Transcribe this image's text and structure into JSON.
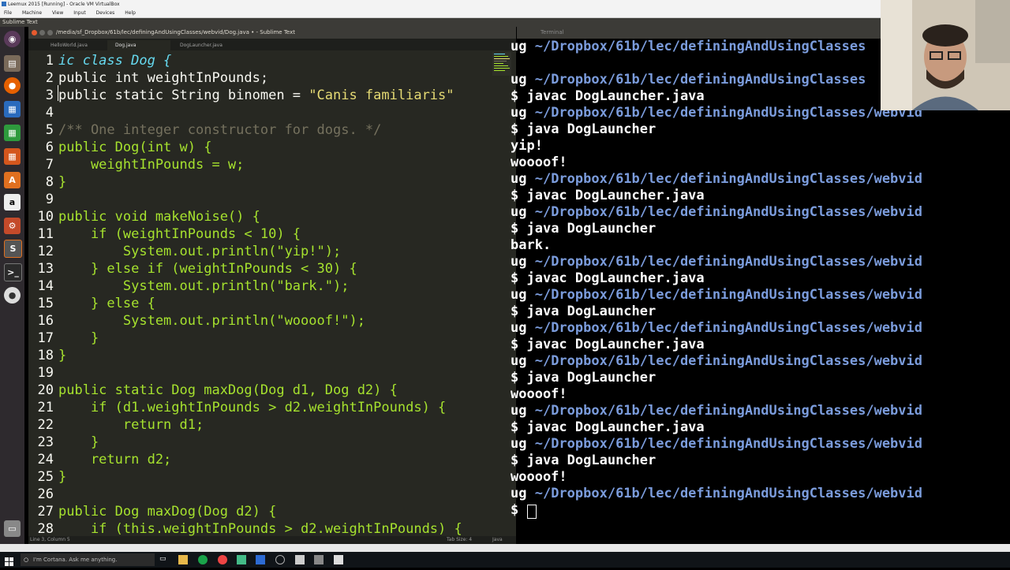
{
  "vbox": {
    "title": "Leemux 2015 [Running] - Oracle VM VirtualBox",
    "menu": [
      "File",
      "Machine",
      "View",
      "Input",
      "Devices",
      "Help"
    ]
  },
  "panel": {
    "app_name": "Sublime Text"
  },
  "sublime": {
    "title": "/media/sf_Dropbox/61b/lec/definingAndUsingClasses/webvid/Dog.java • - Sublime Text",
    "tabs": [
      "HelloWorld.java",
      "Dog.java",
      "DogLauncher.java"
    ],
    "status_left": "Line 3, Column 5",
    "tab_size": "Tab Size: 4",
    "syntax": "Java"
  },
  "code_lines": [
    {
      "n": "1"
    },
    {
      "n": "2"
    },
    {
      "n": "3"
    },
    {
      "n": "4"
    },
    {
      "n": "5"
    },
    {
      "n": "6"
    },
    {
      "n": "7"
    },
    {
      "n": "8"
    },
    {
      "n": "9"
    },
    {
      "n": "10"
    },
    {
      "n": "11"
    },
    {
      "n": "12"
    },
    {
      "n": "13"
    },
    {
      "n": "14"
    },
    {
      "n": "15"
    },
    {
      "n": "16"
    },
    {
      "n": "17"
    },
    {
      "n": "18"
    },
    {
      "n": "19"
    },
    {
      "n": "20"
    },
    {
      "n": "21"
    },
    {
      "n": "22"
    },
    {
      "n": "23"
    },
    {
      "n": "24"
    },
    {
      "n": "25"
    },
    {
      "n": "26"
    },
    {
      "n": "27"
    },
    {
      "n": "28"
    }
  ],
  "code": {
    "l1": "ic class Dog {",
    "l2": "public int weightInPounds;",
    "l3a": "public static String binomen = ",
    "l3b": "\"Canis familiaris\"",
    "l5": "/** One integer constructor for dogs. */",
    "l6": "public Dog(int w) {",
    "l7": "    weightInPounds = w;",
    "l8": "}",
    "l10": "public void makeNoise() {",
    "l11": "    if (weightInPounds < 10) {",
    "l12": "        System.out.println(\"yip!\");",
    "l13": "    } else if (weightInPounds < 30) {",
    "l14": "        System.out.println(\"bark.\");",
    "l15": "    } else {",
    "l16": "        System.out.println(\"woooof!\");",
    "l17": "    }",
    "l18": "}",
    "l20": "public static Dog maxDog(Dog d1, Dog d2) {",
    "l21": "    if (d1.weightInPounds > d2.weightInPounds) {",
    "l22": "        return d1;",
    "l23": "    }",
    "l24": "    return d2;",
    "l25": "}",
    "l27": "public Dog maxDog(Dog d2) {",
    "l28": "    if (this.weightInPounds > d2.weightInPounds) {"
  },
  "terminal": {
    "title": "Terminal",
    "lines": [
      {
        "prefix": "ug ",
        "path": "~/Dropbox/61b/lec/definingAndUsingClasses",
        "cmd": ""
      },
      {
        "prefix": "",
        "path": "",
        "cmd": ""
      },
      {
        "prefix": "ug ",
        "path": "~/Dropbox/61b/lec/definingAndUsingClasses",
        "cmd": ""
      },
      {
        "prefix": "$ ",
        "path": "",
        "cmd": "javac DogLauncher.java"
      },
      {
        "prefix": "ug ",
        "path": "~/Dropbox/61b/lec/definingAndUsingClasses/webvid",
        "cmd": ""
      },
      {
        "prefix": "$ ",
        "path": "",
        "cmd": "java DogLauncher"
      },
      {
        "prefix": "",
        "path": "",
        "cmd": "yip!"
      },
      {
        "prefix": "",
        "path": "",
        "cmd": "woooof!"
      },
      {
        "prefix": "ug ",
        "path": "~/Dropbox/61b/lec/definingAndUsingClasses/webvid",
        "cmd": ""
      },
      {
        "prefix": "$ ",
        "path": "",
        "cmd": "javac DogLauncher.java"
      },
      {
        "prefix": "ug ",
        "path": "~/Dropbox/61b/lec/definingAndUsingClasses/webvid",
        "cmd": ""
      },
      {
        "prefix": "$ ",
        "path": "",
        "cmd": "java DogLauncher"
      },
      {
        "prefix": "",
        "path": "",
        "cmd": "bark."
      },
      {
        "prefix": "ug ",
        "path": "~/Dropbox/61b/lec/definingAndUsingClasses/webvid",
        "cmd": ""
      },
      {
        "prefix": "$ ",
        "path": "",
        "cmd": "javac DogLauncher.java"
      },
      {
        "prefix": "ug ",
        "path": "~/Dropbox/61b/lec/definingAndUsingClasses/webvid",
        "cmd": ""
      },
      {
        "prefix": "$ ",
        "path": "",
        "cmd": "java DogLauncher"
      },
      {
        "prefix": "ug ",
        "path": "~/Dropbox/61b/lec/definingAndUsingClasses/webvid",
        "cmd": ""
      },
      {
        "prefix": "$ ",
        "path": "",
        "cmd": "javac DogLauncher.java"
      },
      {
        "prefix": "ug ",
        "path": "~/Dropbox/61b/lec/definingAndUsingClasses/webvid",
        "cmd": ""
      },
      {
        "prefix": "$ ",
        "path": "",
        "cmd": "java DogLauncher"
      },
      {
        "prefix": "",
        "path": "",
        "cmd": "woooof!"
      },
      {
        "prefix": "ug ",
        "path": "~/Dropbox/61b/lec/definingAndUsingClasses/webvid",
        "cmd": ""
      },
      {
        "prefix": "$ ",
        "path": "",
        "cmd": "javac DogLauncher.java"
      },
      {
        "prefix": "ug ",
        "path": "~/Dropbox/61b/lec/definingAndUsingClasses/webvid",
        "cmd": ""
      },
      {
        "prefix": "$ ",
        "path": "",
        "cmd": "java DogLauncher"
      },
      {
        "prefix": "",
        "path": "",
        "cmd": "woooof!"
      },
      {
        "prefix": "ug ",
        "path": "~/Dropbox/61b/lec/definingAndUsingClasses/webvid",
        "cmd": ""
      },
      {
        "prefix": "$ ",
        "path": "",
        "cmd": ""
      }
    ]
  },
  "taskbar": {
    "cortana_placeholder": "I'm Cortana. Ask me anything."
  },
  "launcher_icons": [
    "ubuntu-dash-icon",
    "files-icon",
    "firefox-icon",
    "writer-icon",
    "calc-icon",
    "impress-icon",
    "software-center-icon",
    "amazon-icon",
    "settings-icon",
    "sublime-icon",
    "terminal-icon",
    "dvd-icon",
    "trash-icon"
  ],
  "colors": {
    "editor_bg": "#272822",
    "keyword": "#66d9ef",
    "string": "#e6db74",
    "comment": "#75715e",
    "terminal_path": "#7b9cdc",
    "launcher_bg": "#2e2a2e"
  }
}
